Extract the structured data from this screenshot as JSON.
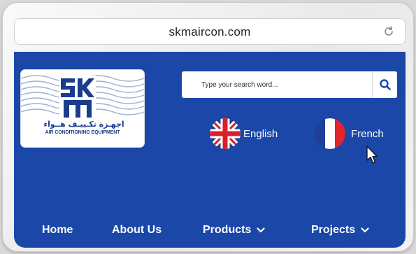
{
  "browser": {
    "url": "skmaircon.com",
    "reload_icon": "reload-icon"
  },
  "site": {
    "logo": {
      "mark_text": "SKM",
      "arabic_text": "اجهـزة تكـييـف هــواء",
      "english_text": "AIR CONDITIONING EQUIPMENT"
    },
    "search": {
      "placeholder": "Type your search word...",
      "icon": "search-icon"
    },
    "languages": [
      {
        "label": "English",
        "icon": "uk-flag-icon"
      },
      {
        "label": "French",
        "icon": "france-flag-icon"
      }
    ],
    "nav": {
      "home": "Home",
      "about": "About Us",
      "products": "Products",
      "projects": "Projects"
    },
    "colors": {
      "header_bg": "#1a47a8",
      "search_icon": "#1a47a8",
      "logo_ink": "#1a3c8c"
    }
  }
}
